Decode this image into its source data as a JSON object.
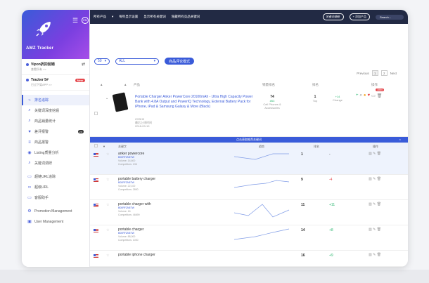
{
  "brand": {
    "title": "AMZ Tracker",
    "lang": "EN"
  },
  "accounts": [
    {
      "name": "Vipon折扣促销",
      "sub": "查看所有 >>"
    },
    {
      "name": "Tracker 5#",
      "sub": "已过下架APP >>",
      "badge": "New"
    }
  ],
  "nav": [
    {
      "label": "排名追踪",
      "icon": "chart-line-icon",
      "active": true
    },
    {
      "label": "关键词深度挖掘",
      "icon": "search-icon"
    },
    {
      "label": "商品销量统计",
      "icon": "search-icon"
    },
    {
      "label": "差评报警",
      "icon": "heart-icon",
      "count": "24"
    },
    {
      "label": "商品报警",
      "icon": "list-icon"
    },
    {
      "label": "Listing质量分析",
      "icon": "eye-icon"
    },
    {
      "label": "关键词调研",
      "icon": "search-icon"
    },
    {
      "label": "超链URL追踪",
      "icon": "chat-icon"
    },
    {
      "label": "超级URL",
      "icon": "link-icon"
    },
    {
      "label": "客服助手",
      "icon": "chat-icon"
    },
    {
      "label": "Promotion Management",
      "icon": "gear-icon"
    },
    {
      "label": "User Management",
      "icon": "user-icon"
    }
  ],
  "topbar": {
    "items": [
      "所有产品",
      "每列显示设置",
      "显示所有关键词",
      "隐藏所有竞品关键词"
    ],
    "btn1": "关键词调研",
    "btn2": "+ 添加产品",
    "search": "Search..."
  },
  "filters": {
    "count": "50",
    "category": "ALL",
    "button": "商品评论模式"
  },
  "pager": {
    "prev": "Previous",
    "p1": "1",
    "p2": "2",
    "next": "Next"
  },
  "table_head": {
    "product": "产品",
    "sales_rank": "销量排名",
    "rank": "排名",
    "change": "",
    "ops": "操作"
  },
  "product": {
    "title": "Portable Charger Anker PowerCore 20100mAh - Ultra High Capacity Power Bank with 4.8A Output and PowerIQ Technology, External Battery Pack for iPhone, iPad & Samsung Galaxy & More (Black)",
    "meta1": "ZCBH9",
    "meta2": "最后上线时间",
    "meta3": "2018-09-19",
    "sales_rank": "74",
    "sales_rank_tag": "#63",
    "sales_rank_cat": "Cell Phones & Accessories",
    "rank": "1",
    "rank_sub": "Top",
    "change": "+14",
    "change_sub": "Change",
    "ops_badge": "1864"
  },
  "subtable": {
    "title": "点击获取推荐关键词",
    "close": "×"
  },
  "kw_head": {
    "keyword": "关键字",
    "trend": "趋势",
    "rank": "排名",
    "ops": "操作"
  },
  "keywords": [
    {
      "name": "anker powercore",
      "asin": "B00RFZN5TW",
      "volume": "Volume: 14,600",
      "comp": "Competitors: 136",
      "rank": "1",
      "change": "-",
      "cls": ""
    },
    {
      "name": "portable battery charger",
      "asin": "B00RFZN5TW",
      "volume": "Volume: 22,100",
      "comp": "Competitors: 2800",
      "rank": "9",
      "change": "-4",
      "cls": "rd"
    },
    {
      "name": "portable charger with",
      "asin": "B00RFZN5TW",
      "volume": "Volume: 16",
      "comp": "Competitors: 46699",
      "rank": "11",
      "change": "+11",
      "cls": "gr"
    },
    {
      "name": "portable charger",
      "asin": "B00RFZN5TW",
      "volume": "Volume: 88,000",
      "comp": "Competitors: 1000",
      "rank": "14",
      "change": "+8",
      "cls": "gr"
    },
    {
      "name": "portable iphone charger",
      "asin": "",
      "volume": "",
      "comp": "",
      "rank": "16",
      "change": "+9",
      "cls": "gr"
    }
  ]
}
